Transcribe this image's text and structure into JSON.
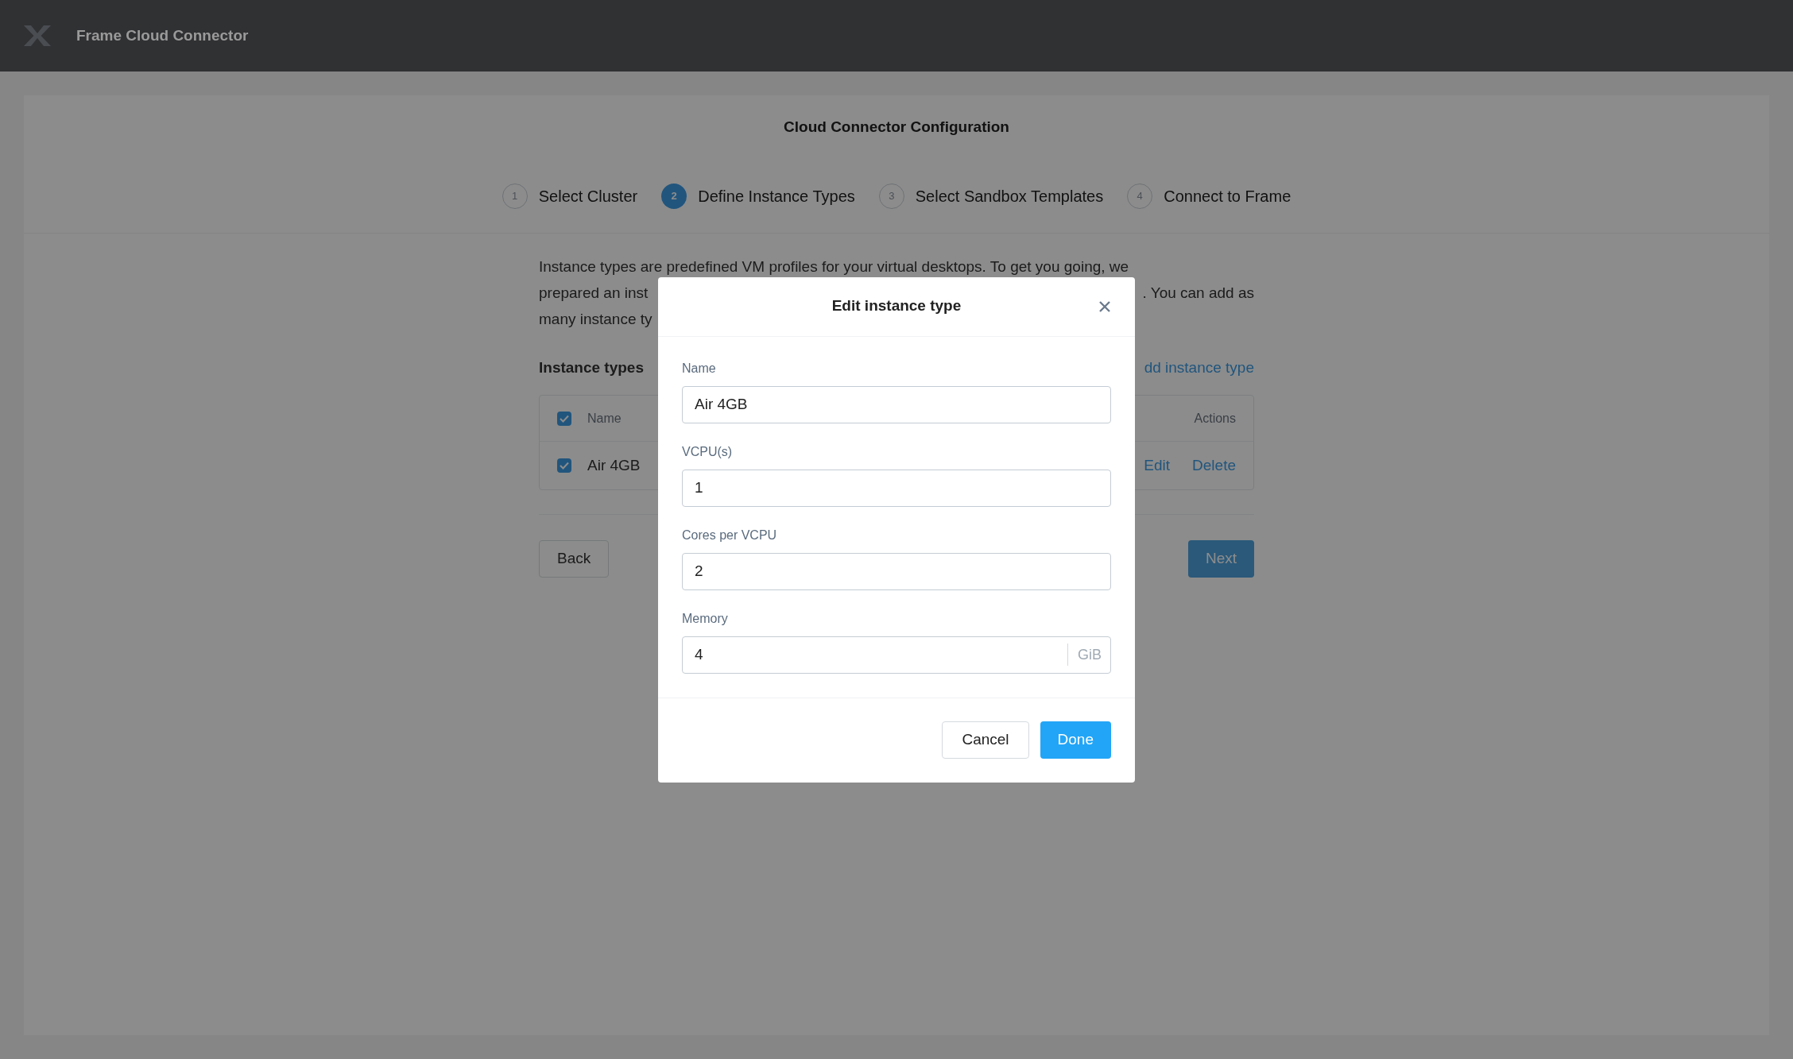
{
  "app_bar": {
    "title": "Frame Cloud Connector"
  },
  "page": {
    "title": "Cloud Connector Configuration",
    "steps": [
      {
        "number": "1",
        "label": "Select Cluster",
        "selected": false
      },
      {
        "number": "2",
        "label": "Define Instance Types",
        "selected": true
      },
      {
        "number": "3",
        "label": "Select Sandbox Templates",
        "selected": false
      },
      {
        "number": "4",
        "label": "Connect to Frame",
        "selected": false
      }
    ],
    "intro_lines": [
      {
        "left": "Instance types are predefined VM profiles for your virtual desktops. To get you going, we"
      },
      {
        "left": "prepared an inst",
        "right": ". You can add as"
      },
      {
        "left": "many instance ty"
      }
    ],
    "section_title": "Instance types",
    "add_link": "dd instance type",
    "table": {
      "header_checked": true,
      "columns": [
        "Name",
        "Actions"
      ],
      "rows": [
        {
          "checked": true,
          "name": "Air 4GB",
          "actions": [
            "Edit",
            "Delete"
          ]
        }
      ]
    },
    "back_button": "Back",
    "next_button": "Next"
  },
  "dialog": {
    "title": "Edit instance type",
    "fields": [
      {
        "label": "Name",
        "value": "Air 4GB"
      },
      {
        "label": "VCPU(s)",
        "value": "1"
      },
      {
        "label": "Cores per VCPU",
        "value": "2"
      },
      {
        "label": "Memory",
        "value": "4",
        "unit": "GiB"
      }
    ],
    "cancel": "Cancel",
    "done": "Done"
  }
}
